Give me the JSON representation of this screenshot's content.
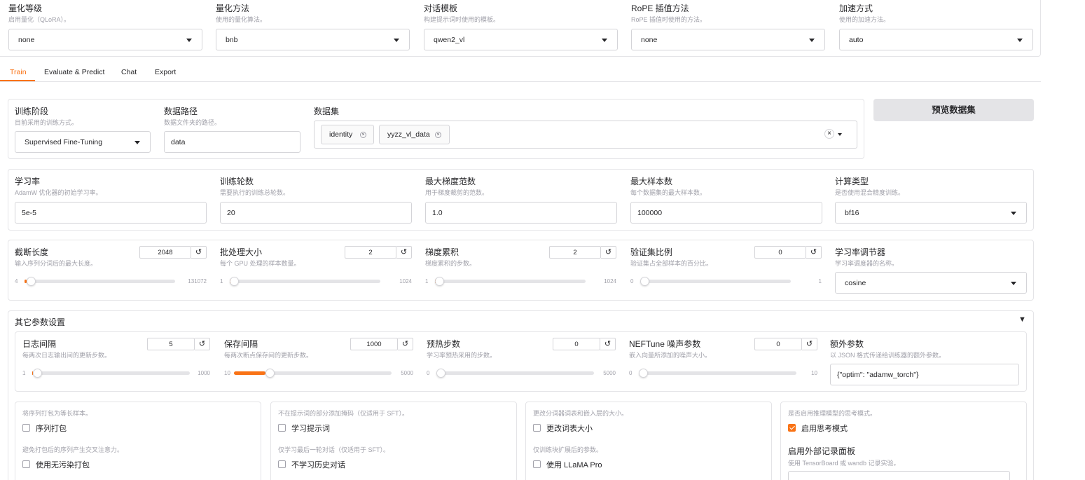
{
  "top_row": [
    {
      "label": "量化等级",
      "desc": "启用量化（QLoRA）。",
      "value": "none"
    },
    {
      "label": "量化方法",
      "desc": "使用的量化算法。",
      "value": "bnb"
    },
    {
      "label": "对话模板",
      "desc": "构建提示词时使用的模板。",
      "value": "qwen2_vl"
    },
    {
      "label": "RoPE 插值方法",
      "desc": "RoPE 插值时使用的方法。",
      "value": "none"
    },
    {
      "label": "加速方式",
      "desc": "使用的加速方法。",
      "value": "auto"
    }
  ],
  "tabs": [
    "Train",
    "Evaluate & Predict",
    "Chat",
    "Export"
  ],
  "active_tab": "Train",
  "stage": {
    "label": "训练阶段",
    "desc": "目前采用的训练方式。",
    "value": "Supervised Fine-Tuning"
  },
  "data_path": {
    "label": "数据路径",
    "desc": "数据文件夹的路径。",
    "value": "data"
  },
  "dataset": {
    "label": "数据集",
    "tags": [
      "identity",
      "yyzz_vl_data"
    ]
  },
  "preview_button": "预览数据集",
  "row2": [
    {
      "label": "学习率",
      "desc": "AdamW 优化器的初始学习率。",
      "value": "5e-5"
    },
    {
      "label": "训练轮数",
      "desc": "需要执行的训练总轮数。",
      "value": "20"
    },
    {
      "label": "最大梯度范数",
      "desc": "用于梯度裁剪的范数。",
      "value": "1.0"
    },
    {
      "label": "最大样本数",
      "desc": "每个数据集的最大样本数。",
      "value": "100000"
    },
    {
      "label": "计算类型",
      "desc": "是否使用混合精度训练。",
      "value": "bf16"
    }
  ],
  "row3": [
    {
      "label": "截断长度",
      "desc": "输入序列分词后的最大长度。",
      "value": "2048",
      "min": "4",
      "max": "131072",
      "level": 0.015
    },
    {
      "label": "批处理大小",
      "desc": "每个 GPU 处理的样本数量。",
      "value": "2",
      "min": "1",
      "max": "1024",
      "level": 0.001
    },
    {
      "label": "梯度累积",
      "desc": "梯度累积的步数。",
      "value": "2",
      "min": "1",
      "max": "1024",
      "level": 0.001
    },
    {
      "label": "验证集比例",
      "desc": "验证集占全部样本的百分比。",
      "value": "0",
      "min": "0",
      "max": "1",
      "level": 0
    }
  ],
  "scheduler": {
    "label": "学习率调节器",
    "desc": "学习率调度器的名称。",
    "value": "cosine"
  },
  "other_section": {
    "title": "其它参数设置",
    "toggle": "▼"
  },
  "row4": [
    {
      "label": "日志间隔",
      "desc": "每两次日志输出间的更新步数。",
      "value": "5",
      "min": "1",
      "max": "1000",
      "level": 0.004
    },
    {
      "label": "保存间隔",
      "desc": "每两次断点保存间的更新步数。",
      "value": "1000",
      "min": "10",
      "max": "5000",
      "level": 0.198
    },
    {
      "label": "预热步数",
      "desc": "学习率预热采用的步数。",
      "value": "0",
      "min": "0",
      "max": "5000",
      "level": 0
    },
    {
      "label": "NEFTune 噪声参数",
      "desc": "嵌入向量所添加的噪声大小。",
      "value": "0",
      "min": "0",
      "max": "10",
      "level": 0
    }
  ],
  "extra_args": {
    "label": "额外参数",
    "desc": "以 JSON 格式传递给训练器的额外参数。",
    "value": "{\"optim\": \"adamw_torch\"}"
  },
  "checkbox_groups": [
    {
      "items": [
        {
          "desc": "将序列打包为等长样本。",
          "label": "序列打包",
          "checked": false
        },
        {
          "desc": "避免打包后的序列产生交叉注意力。",
          "label": "使用无污染打包",
          "checked": false
        }
      ]
    },
    {
      "items": [
        {
          "desc": "不在提示词的部分添加掩码（仅适用于 SFT）。",
          "label": "学习提示词",
          "checked": false
        },
        {
          "desc": "仅学习最后一轮对话（仅适用于 SFT）。",
          "label": "不学习历史对话",
          "checked": false
        }
      ]
    },
    {
      "items": [
        {
          "desc": "更改分词器词表和嵌入层的大小。",
          "label": "更改词表大小",
          "checked": false
        },
        {
          "desc": "仅训练块扩展后的参数。",
          "label": "使用 LLaMA Pro",
          "checked": false
        }
      ]
    },
    {
      "items": [
        {
          "desc": "是否启用推理模型的思考模式。",
          "label": "启用思考模式",
          "checked": true
        }
      ]
    }
  ],
  "report": {
    "label": "启用外部记录面板",
    "desc": "使用 TensorBoard 或 wandb 记录实验。"
  },
  "colors": {
    "accent": "#f97316",
    "border": "#e4e4e7",
    "button_bg": "#e4e4e7"
  }
}
